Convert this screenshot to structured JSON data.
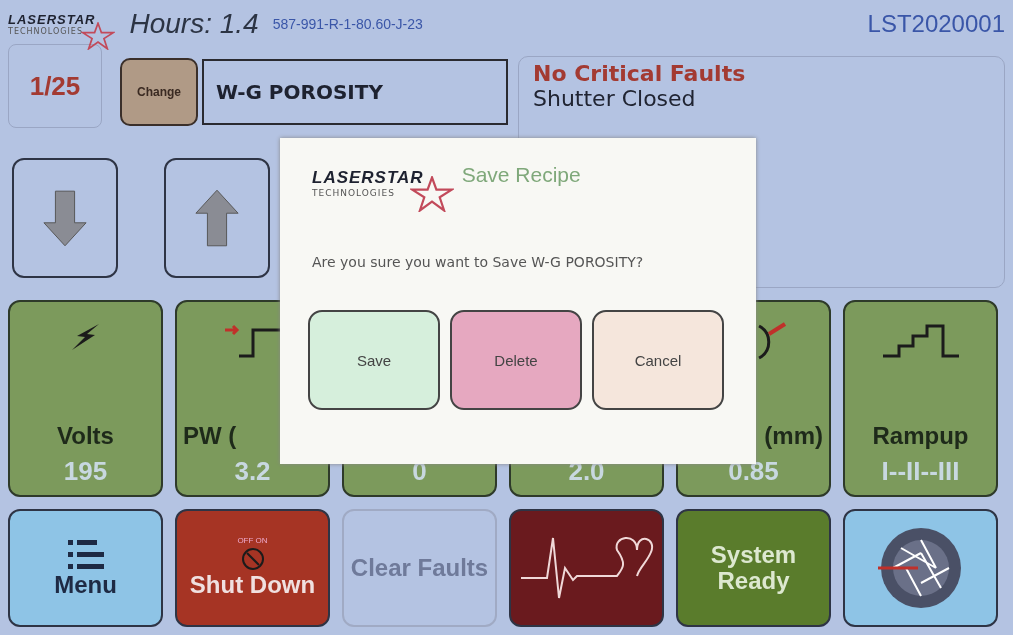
{
  "header": {
    "logo": {
      "name": "LASERSTAR",
      "tagline": "TECHNOLOGIES"
    },
    "hours": "Hours: 1.4",
    "part_number": "587-991-R-1-80.60-J-23",
    "serial": "LST2020001"
  },
  "recipe": {
    "counter": "1/25",
    "change_button": "Change",
    "name": "W-G POROSITY"
  },
  "status": {
    "faults": "No Critical Faults",
    "shutter": "Shutter Closed"
  },
  "nav_buttons": [
    {
      "kind": "down"
    },
    {
      "kind": "up"
    }
  ],
  "parameters": [
    {
      "kind": "bolt",
      "label": "Volts",
      "value": "195"
    },
    {
      "kind": "pulse",
      "label": "PW (",
      "value": "3.2"
    },
    {
      "kind": "none",
      "value": "0"
    },
    {
      "kind": "none",
      "value": "2.0"
    },
    {
      "kind": "spot",
      "label": "(mm)",
      "value": "0.85"
    },
    {
      "kind": "steps",
      "label": "Rampup",
      "value": "I--II--III"
    }
  ],
  "bottom_buttons": [
    {
      "kind": "menu",
      "label": "Menu",
      "disabled": false
    },
    {
      "kind": "shutdown",
      "label": "Shut Down",
      "disabled": false,
      "dial": "OFF ON"
    },
    {
      "kind": "clear",
      "label": "Clear Faults",
      "disabled": true
    },
    {
      "kind": "heart",
      "disabled": false
    },
    {
      "kind": "ready",
      "label": "System Ready",
      "disabled": false
    },
    {
      "kind": "shutter",
      "disabled": false
    }
  ],
  "dialog": {
    "logo": {
      "name": "LASERSTAR",
      "tagline": "TECHNOLOGIES"
    },
    "title": "Save Recipe",
    "message": "Are you sure you want to Save W-G POROSITY?",
    "buttons": [
      {
        "label": "Save",
        "color": "#d6efdc"
      },
      {
        "label": "Delete",
        "color": "#e6a8c0"
      },
      {
        "label": "Cancel",
        "color": "#f5e6dc"
      }
    ]
  }
}
